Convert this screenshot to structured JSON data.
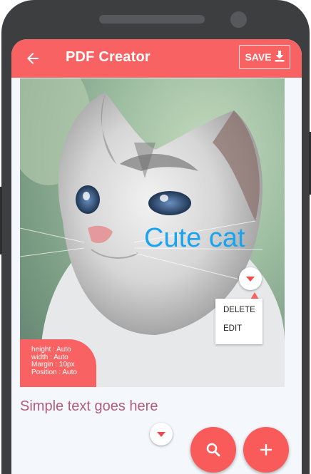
{
  "appbar": {
    "title": "PDF Creator",
    "back_icon": "arrow-left-icon",
    "save_label": "SAVE",
    "save_icon": "download-icon",
    "color": "#f96262"
  },
  "canvas": {
    "image_subject": "kitten photo",
    "caption": "Cute cat",
    "caption_color": "#1aa3ef",
    "dropdown_icon": "caret-down-icon",
    "context_menu": {
      "items": [
        "DELETE",
        "EDIT"
      ]
    },
    "properties": [
      "height : Auto",
      "width : Auto",
      "Margin : 10px",
      "Position : Auto"
    ]
  },
  "text_block": {
    "text": "Simple text goes here",
    "color": "#b05d78"
  },
  "fabs": {
    "search_icon": "search-icon",
    "add_icon": "plus-icon",
    "color": "#f95a5a"
  }
}
